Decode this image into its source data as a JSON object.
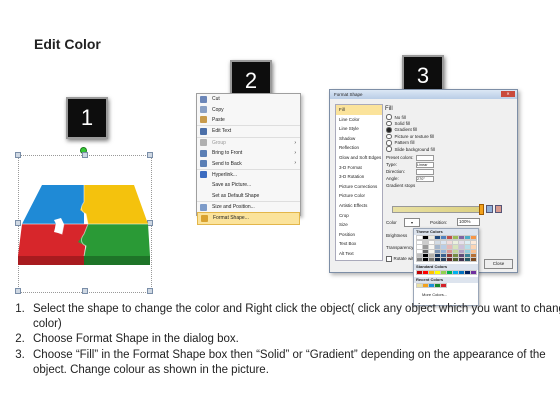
{
  "title": "Edit Color",
  "badges": [
    "1",
    "2",
    "3"
  ],
  "context_menu": {
    "items": [
      {
        "label": "Cut",
        "icon": "scissors-icon",
        "color": "#6b86b8"
      },
      {
        "label": "Copy",
        "icon": "copy-icon",
        "color": "#8aa0c4"
      },
      {
        "label": "Paste",
        "icon": "paste-icon",
        "color": "#c89b4c"
      },
      {
        "label": "Edit Text",
        "icon": "edit-text-icon",
        "color": "#4b6fa8"
      },
      {
        "label": "Group",
        "icon": "group-icon",
        "color": "#b0b0b0",
        "disabled": true,
        "submenu": true
      },
      {
        "label": "Bring to Front",
        "icon": "bring-front-icon",
        "color": "#5b7fb5",
        "submenu": true
      },
      {
        "label": "Send to Back",
        "icon": "send-back-icon",
        "color": "#5b7fb5",
        "submenu": true
      },
      {
        "label": "Hyperlink...",
        "icon": "hyperlink-icon",
        "color": "#3c6cc0"
      },
      {
        "label": "Save as Picture...",
        "icon": "",
        "color": ""
      },
      {
        "label": "Set as Default Shape",
        "icon": "",
        "color": ""
      },
      {
        "label": "Size and Position...",
        "icon": "size-position-icon",
        "color": "#7d9bc9"
      },
      {
        "label": "Format Shape...",
        "icon": "format-shape-icon",
        "color": "#d9a230"
      }
    ]
  },
  "format_dialog": {
    "title": "Format Shape",
    "nav": [
      "Fill",
      "Line Color",
      "Line Style",
      "Shadow",
      "Reflection",
      "Glow and Soft Edges",
      "3-D Format",
      "3-D Rotation",
      "Picture Corrections",
      "Picture Color",
      "Artistic Effects",
      "Crop",
      "Size",
      "Position",
      "Text Box",
      "Alt Text"
    ],
    "section": "Fill",
    "fill_options": [
      "No fill",
      "Solid fill",
      "Gradient fill",
      "Picture or texture fill",
      "Pattern fill",
      "Slide background fill"
    ],
    "selected_fill": "Gradient fill",
    "props": [
      {
        "label": "Preset colors:",
        "value": ""
      },
      {
        "label": "Type:",
        "value": "Linear"
      },
      {
        "label": "Direction:",
        "value": ""
      },
      {
        "label": "Angle:",
        "value": "270°"
      }
    ],
    "gradient_stops_label": "Gradient stops",
    "color_label": "Color",
    "position_label": "Position:",
    "position_value": "100%",
    "brightness_label": "Brightness",
    "transparency_label": "Transparency",
    "rotate_label": "Rotate with shape",
    "close_label": "Close",
    "palette": {
      "theme_label": "Theme Colors",
      "standard_label": "Standard Colors",
      "recent_label": "Recent Colors",
      "more_label": "More Colors...",
      "theme_top": [
        "#ffffff",
        "#000000",
        "#eeece1",
        "#1f497d",
        "#4f81bd",
        "#c0504d",
        "#9bbb59",
        "#8064a2",
        "#4bacc6",
        "#f79646"
      ],
      "standard": [
        "#c00000",
        "#ff0000",
        "#ffc000",
        "#ffff00",
        "#92d050",
        "#00b050",
        "#00b0f0",
        "#0070c0",
        "#002060",
        "#7030a0"
      ],
      "recent": [
        "#e9e1a4",
        "#f3a21c",
        "#1e90d8",
        "#1a8a2a",
        "#d4212a"
      ]
    }
  },
  "puzzle_colors": {
    "blue": "#1f8ad6",
    "yellow": "#f4c20d",
    "red": "#d7262b",
    "green": "#2a9a36"
  },
  "instructions": [
    "Select the shape to change the color and Right click the object( click any object which you want to change color)",
    "Choose Format Shape in the dialog box.",
    "Choose “Fill” in the Format Shape box then “Solid” or “Gradient” depending on the appearance of the object. Change colour as shown in the picture."
  ]
}
